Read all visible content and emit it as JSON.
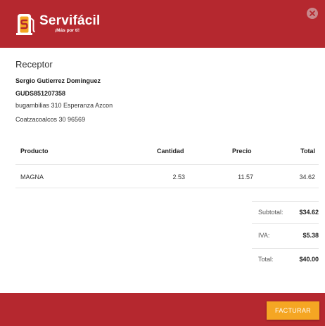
{
  "header": {
    "brand_name": "Servifácil",
    "brand_tagline": "¡Más por ti!",
    "close_icon": "close-icon",
    "background": "#b5282f"
  },
  "receptor": {
    "title": "Receptor",
    "name": "Sergio Gutierrez Dominguez",
    "rfc": "GUDS851207358",
    "address_line1": "bugambilias  310 Esperanza Azcon",
    "address_line2": "Coatzacoalcos 30  96569"
  },
  "table": {
    "headers": [
      "Producto",
      "Cantidad",
      "Precio",
      "Total"
    ],
    "rows": [
      {
        "producto": "MAGNA",
        "cantidad": "2.53",
        "precio": "11.57",
        "total": "34.62"
      }
    ]
  },
  "summary": {
    "subtotal_label": "Subtotal:",
    "subtotal_value": "$34.62",
    "iva_label": "IVA:",
    "iva_value": "$5.38",
    "total_label": "Total:",
    "total_value": "$40.00"
  },
  "footer": {
    "facturar_label": "FACTURAR",
    "button_color": "#f5a623"
  }
}
